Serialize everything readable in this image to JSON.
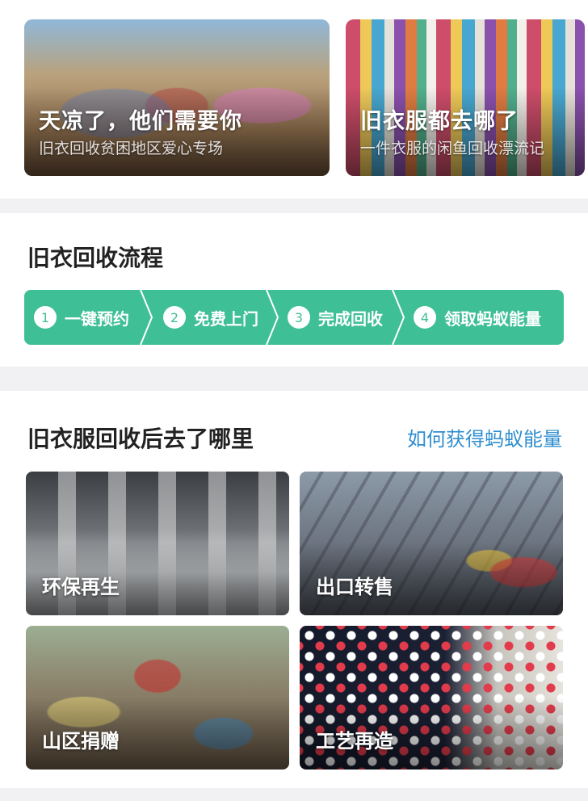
{
  "banners": [
    {
      "title": "天凉了，他们需要你",
      "subtitle": "旧衣回收贫困地区爱心专场"
    },
    {
      "title": "旧衣服都去哪了",
      "subtitle": "一件衣服的闲鱼回收漂流记"
    }
  ],
  "process": {
    "title": "旧衣回收流程",
    "accent_color": "#3fbf96",
    "steps": [
      {
        "num": "1",
        "label": "一键预约"
      },
      {
        "num": "2",
        "label": "免费上门"
      },
      {
        "num": "3",
        "label": "完成回收"
      },
      {
        "num": "4",
        "label": "领取蚂蚁能量"
      }
    ]
  },
  "destinations": {
    "title": "旧衣服回收后去了哪里",
    "link": "如何获得蚂蚁能量",
    "link_color": "#2f8ecf",
    "tiles": [
      {
        "label": "环保再生"
      },
      {
        "label": "出口转售"
      },
      {
        "label": "山区捐赠"
      },
      {
        "label": "工艺再造"
      }
    ]
  }
}
